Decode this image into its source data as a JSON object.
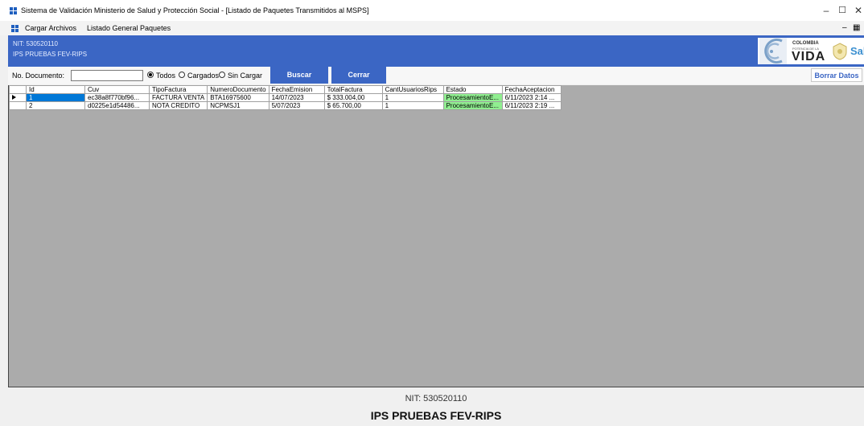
{
  "window": {
    "title": "Sistema de Validación Ministerio de Salud y Protección Social - [Listado de Paquetes Transmitidos al MSPS]"
  },
  "menu": {
    "items": [
      "Cargar Archivos",
      "Listado General Paquetes"
    ]
  },
  "banner": {
    "nit": "NIT: 530520110",
    "ips": "IPS PRUEBAS FEV-RIPS",
    "logo_top": "COLOMBIA",
    "logo_sub": "POTENCIA DE LA",
    "logo_main": "VIDA",
    "logo_right": "Salu"
  },
  "filter": {
    "doc_label": "No. Documento:",
    "doc_value": "",
    "radio_todos": "Todos",
    "radio_cargados": "Cargados",
    "radio_sin": "Sin Cargar",
    "selected": "Todos",
    "buscar": "Buscar",
    "cerrar": "Cerrar",
    "borrar": "Borrar Datos"
  },
  "grid": {
    "columns": [
      "Id",
      "Cuv",
      "TipoFactura",
      "NumeroDocumento",
      "FechaEmision",
      "TotalFactura",
      "CantUsuariosRips",
      "Estado",
      "FechaAceptacion"
    ],
    "rows": [
      [
        "1",
        "ec38a8f770bf96...",
        "FACTURA VENTA",
        "BTA16975600",
        "14/07/2023",
        "$ 333.004,00",
        "1",
        "ProcesamientoE...",
        "6/11/2023 2:14 ..."
      ],
      [
        "2",
        "d0225e1d54486...",
        "NOTA CREDITO",
        "NCPMSJ1",
        "5/07/2023",
        "$ 65.700,00",
        "1",
        "ProcesamientoE...",
        "6/11/2023 2:19 ..."
      ]
    ]
  },
  "footer": {
    "nit": "NIT: 530520110",
    "ips": "IPS PRUEBAS FEV-RIPS"
  },
  "colors": {
    "accent": "#3b66c4",
    "selection": "#0078d7",
    "status_green": "#90ee90"
  }
}
